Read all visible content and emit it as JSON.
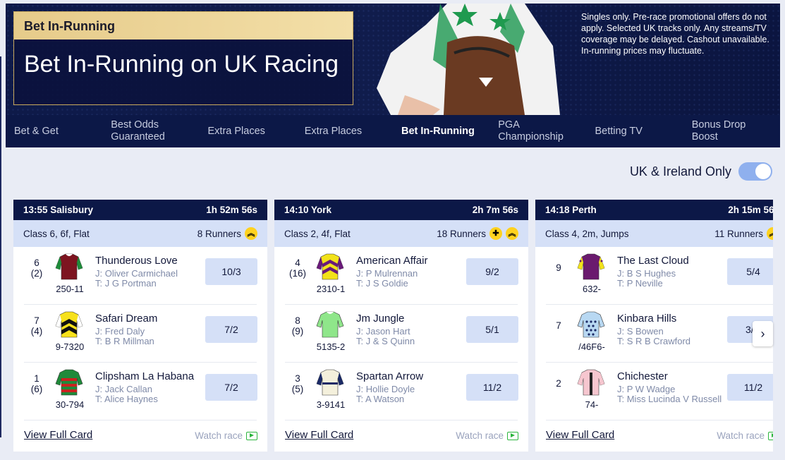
{
  "banner": {
    "tag": "Bet In-Running",
    "title": "Bet In-Running on UK Racing",
    "disclaimer": "Singles only. Pre-race promotional offers do not apply. Selected UK tracks only. Any streams/TV coverage may be delayed. Cashout unavailable. In-running prices may fluctuate."
  },
  "nav": [
    {
      "label": "Bet & Get",
      "active": false
    },
    {
      "label": "Best Odds Guaranteed",
      "active": false
    },
    {
      "label": "Extra Places",
      "active": false
    },
    {
      "label": "Extra Places",
      "active": false
    },
    {
      "label": "Bet In-Running",
      "active": true
    },
    {
      "label": "PGA Championship",
      "active": false
    },
    {
      "label": "Betting TV",
      "active": false
    },
    {
      "label": "Bonus Drop Boost",
      "active": false
    }
  ],
  "filter": {
    "label": "UK & Ireland Only",
    "on": true
  },
  "footer": {
    "view_card": "View Full Card",
    "watch": "Watch race"
  },
  "races": [
    {
      "time_venue": "13:55 Salisbury",
      "countdown": "1h 52m 56s",
      "info": "Class 6, 6f, Flat",
      "runners_label": "8 Runners",
      "icons": [
        "chevron-up-icon"
      ],
      "runners": [
        {
          "number": "6",
          "draw": "(2)",
          "form": "250-11",
          "name": "Thunderous Love",
          "jockey": "J: Oliver Carmichael",
          "trainer": "T: J G Portman",
          "odds": "10/3",
          "silks": "maroon-green"
        },
        {
          "number": "7",
          "draw": "(4)",
          "form": "9-7320",
          "name": "Safari Dream",
          "jockey": "J: Fred Daly",
          "trainer": "T: B R Millman",
          "odds": "7/2",
          "silks": "yellow-black-chevrons"
        },
        {
          "number": "1",
          "draw": "(6)",
          "form": "30-794",
          "name": "Clipsham La Habana",
          "jockey": "J: Jack Callan",
          "trainer": "T: Alice Haynes",
          "odds": "7/2",
          "silks": "green-red-hoops"
        }
      ]
    },
    {
      "time_venue": "14:10 York",
      "countdown": "2h 7m 56s",
      "info": "Class 2, 4f, Flat",
      "runners_label": "18 Runners",
      "icons": [
        "plus-icon",
        "chevron-up-icon"
      ],
      "runners": [
        {
          "number": "4",
          "draw": "(16)",
          "form": "2310-1",
          "name": "American Affair",
          "jockey": "J: P Mulrennan",
          "trainer": "T: J S Goldie",
          "odds": "9/2",
          "silks": "yellow-purple-chevrons"
        },
        {
          "number": "8",
          "draw": "(9)",
          "form": "5135-2",
          "name": "Jm Jungle",
          "jockey": "J: Jason Hart",
          "trainer": "T: J & S Quinn",
          "odds": "5/1",
          "silks": "light-green"
        },
        {
          "number": "3",
          "draw": "(5)",
          "form": "3-9141",
          "name": "Spartan Arrow",
          "jockey": "J: Hollie Doyle",
          "trainer": "T: A Watson",
          "odds": "11/2",
          "silks": "cream-navy"
        }
      ]
    },
    {
      "time_venue": "14:18 Perth",
      "countdown": "2h 15m 56s",
      "info": "Class 4, 2m, Jumps",
      "runners_label": "11 Runners",
      "icons": [
        "chevron-up-icon"
      ],
      "runners": [
        {
          "number": "9",
          "draw": "",
          "form": "632-",
          "name": "The Last Cloud",
          "jockey": "J: B S Hughes",
          "trainer": "T: P Neville",
          "odds": "5/4",
          "silks": "purple-yellow"
        },
        {
          "number": "7",
          "draw": "",
          "form": "/46F6-",
          "name": "Kinbara Hills",
          "jockey": "J: S Bowen",
          "trainer": "T: S R B Crawford",
          "odds": "3/1",
          "silks": "lightblue-navy-spots"
        },
        {
          "number": "2",
          "draw": "",
          "form": "74-",
          "name": "Chichester",
          "jockey": "J: P W Wadge",
          "trainer": "T: Miss Lucinda V Russell",
          "odds": "11/2",
          "silks": "pink-black"
        }
      ]
    }
  ]
}
